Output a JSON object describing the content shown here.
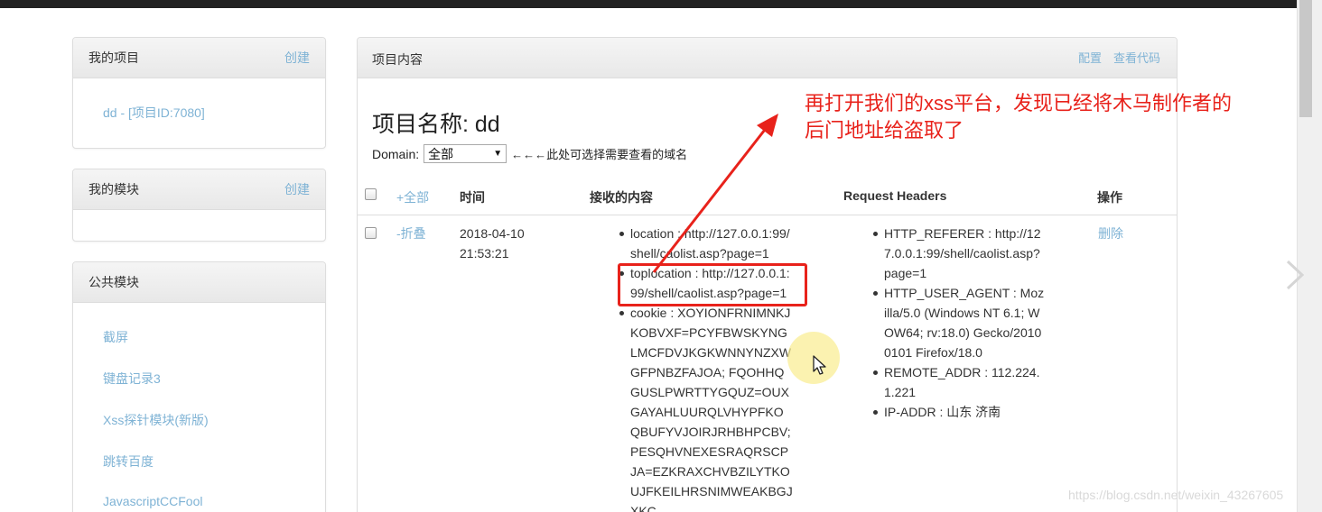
{
  "sidebar": {
    "my_projects": {
      "title": "我的项目",
      "action": "创建",
      "items": [
        "dd - [项目ID:7080]"
      ]
    },
    "my_modules": {
      "title": "我的模块",
      "action": "创建"
    },
    "public_modules": {
      "title": "公共模块",
      "items": [
        "截屏",
        "键盘记录3",
        "Xss探针模块(新版)",
        "跳转百度",
        "JavascriptCCFool"
      ]
    }
  },
  "main": {
    "title": "项目内容",
    "config_link": "配置",
    "view_code_link": "查看代码",
    "project_name": "项目名称: dd",
    "domain_label": "Domain:",
    "domain_value": "全部",
    "domain_hint": "←←←此处可选择需要查看的域名",
    "columns": {
      "all": "+全部",
      "time": "时间",
      "content": "接收的内容",
      "headers": "Request Headers",
      "ops": "操作"
    },
    "row": {
      "collapse": "-折叠",
      "date": "2018-04-10",
      "clock": "21:53:21",
      "content": {
        "location": "location : http://127.0.0.1:99/ shell/caolist.asp?page=1",
        "toplocation": "toplocation : http://127.0.0.1: 99/shell/caolist.asp?page=1",
        "cookie": "cookie : XOYIONFRNIMNKJ KOBVXF=PCYFBWSKYNG LMCFDVJKGKWNNYNZXW GFPNBZFAJOA; FQOHHQ GUSLPWRTTYGQUZ=OUX GAYAHLUURQLVHYPFKO QBUFYVJOIRJRHBHPCBV; PESQHVNEXESRAQRSCP JA=EZKRAXCHVBZILYTKO UJFKEILHRSNIMWEAKBGJ XKC"
      },
      "headers": {
        "referer": "HTTP_REFERER : http://12 7.0.0.1:99/shell/caolist.asp? page=1",
        "user_agent": "HTTP_USER_AGENT : Moz illa/5.0 (Windows NT 6.1; W OW64; rv:18.0) Gecko/2010 0101 Firefox/18.0",
        "remote_addr": "REMOTE_ADDR : 112.224. 1.221",
        "ip_addr": "IP-ADDR : 山东 济南"
      },
      "delete": "删除"
    }
  },
  "annotation": {
    "line1": "再打开我们的xss平台，发现已经将木马制作者的",
    "line2": "后门地址给盗取了"
  },
  "watermark": "https://blog.csdn.net/weixin_43267605",
  "colors": {
    "link": "#7fb3d5",
    "annotation": "#e8221b"
  }
}
